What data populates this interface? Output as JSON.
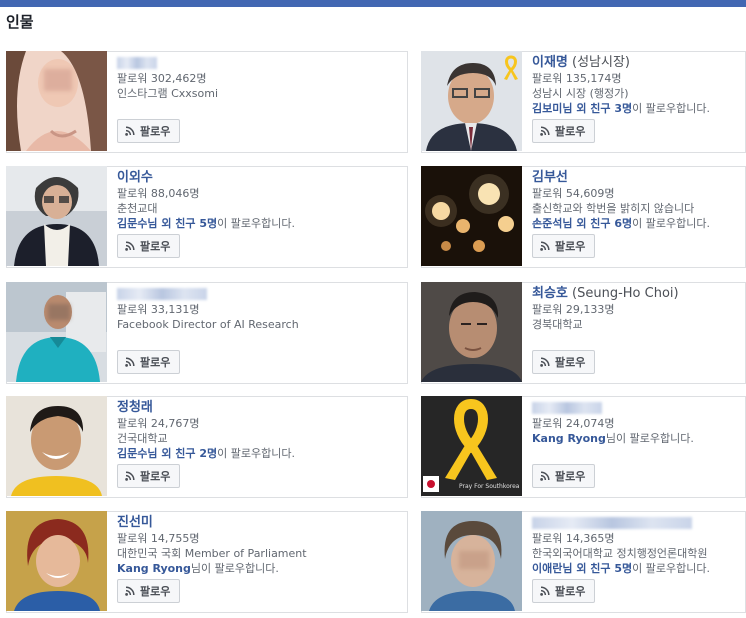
{
  "section_title": "인물",
  "follow_label": "팔로우",
  "colors": {
    "link": "#365899",
    "topbar": "#4267b2",
    "ribbon": "#f7c51e"
  },
  "people": [
    {
      "id": "p1",
      "name": "",
      "name_suffix": "",
      "name_blurred": true,
      "followers": "팔로워 302,462명",
      "detail": "인스타그램 Cxxsomi",
      "mutual_prefix": "",
      "mutual_link": "",
      "mutual_text": ""
    },
    {
      "id": "p2",
      "name": "이재명",
      "name_suffix": " (성남시장)",
      "name_blurred": false,
      "followers": "팔로워 135,174명",
      "detail": "성남시 시장 (행정가)",
      "mutual_prefix": "김보미",
      "mutual_link": "님 외 친구 3명",
      "mutual_text": "이 팔로우합니다."
    },
    {
      "id": "p3",
      "name": "이외수",
      "name_suffix": "",
      "name_blurred": false,
      "followers": "팔로워 88,046명",
      "detail": "춘천교대",
      "mutual_prefix": "김문수",
      "mutual_link": "님 외 친구 5명",
      "mutual_text": "이 팔로우합니다."
    },
    {
      "id": "p4",
      "name": "김부선",
      "name_suffix": "",
      "name_blurred": false,
      "followers": "팔로워 54,609명",
      "detail": "출신학교와 학번을 밝히지 않습니다",
      "mutual_prefix": "손준석",
      "mutual_link": "님 외 친구 6명",
      "mutual_text": "이 팔로우합니다."
    },
    {
      "id": "p5",
      "name": "",
      "name_suffix": "",
      "name_blurred": true,
      "followers": "팔로워 33,131명",
      "detail": "Facebook Director of AI Research",
      "mutual_prefix": "",
      "mutual_link": "",
      "mutual_text": ""
    },
    {
      "id": "p6",
      "name": "최승호",
      "name_suffix": " (Seung-Ho Choi)",
      "name_blurred": false,
      "followers": "팔로워 29,133명",
      "detail": "경북대학교",
      "mutual_prefix": "",
      "mutual_link": "",
      "mutual_text": ""
    },
    {
      "id": "p7",
      "name": "정청래",
      "name_suffix": "",
      "name_blurred": false,
      "followers": "팔로워 24,767명",
      "detail": "건국대학교",
      "mutual_prefix": "김문수",
      "mutual_link": "님 외 친구 2명",
      "mutual_text": "이 팔로우합니다."
    },
    {
      "id": "p8",
      "name": "",
      "name_suffix": "",
      "name_blurred": true,
      "followers": "팔로워 24,074명",
      "detail": "",
      "mutual_prefix": "Kang Ryong",
      "mutual_link": "",
      "mutual_text": "님이 팔로우합니다."
    },
    {
      "id": "p9",
      "name": "진선미",
      "name_suffix": "",
      "name_blurred": false,
      "followers": "팔로워 14,755명",
      "detail": "대한민국 국회 Member of Parliament",
      "mutual_prefix": "Kang Ryong",
      "mutual_link": "",
      "mutual_text": "님이 팔로우합니다."
    },
    {
      "id": "p10",
      "name": "",
      "name_suffix": "",
      "name_blurred": true,
      "followers": "팔로워 14,365명",
      "detail": "한국외국어대학교 정치행정언론대학원",
      "mutual_prefix": "이애란",
      "mutual_link": "님 외 친구 5명",
      "mutual_text": "이 팔로우합니다."
    }
  ],
  "photo_texts": {
    "p8_caption": "Pray For Southkorea"
  }
}
